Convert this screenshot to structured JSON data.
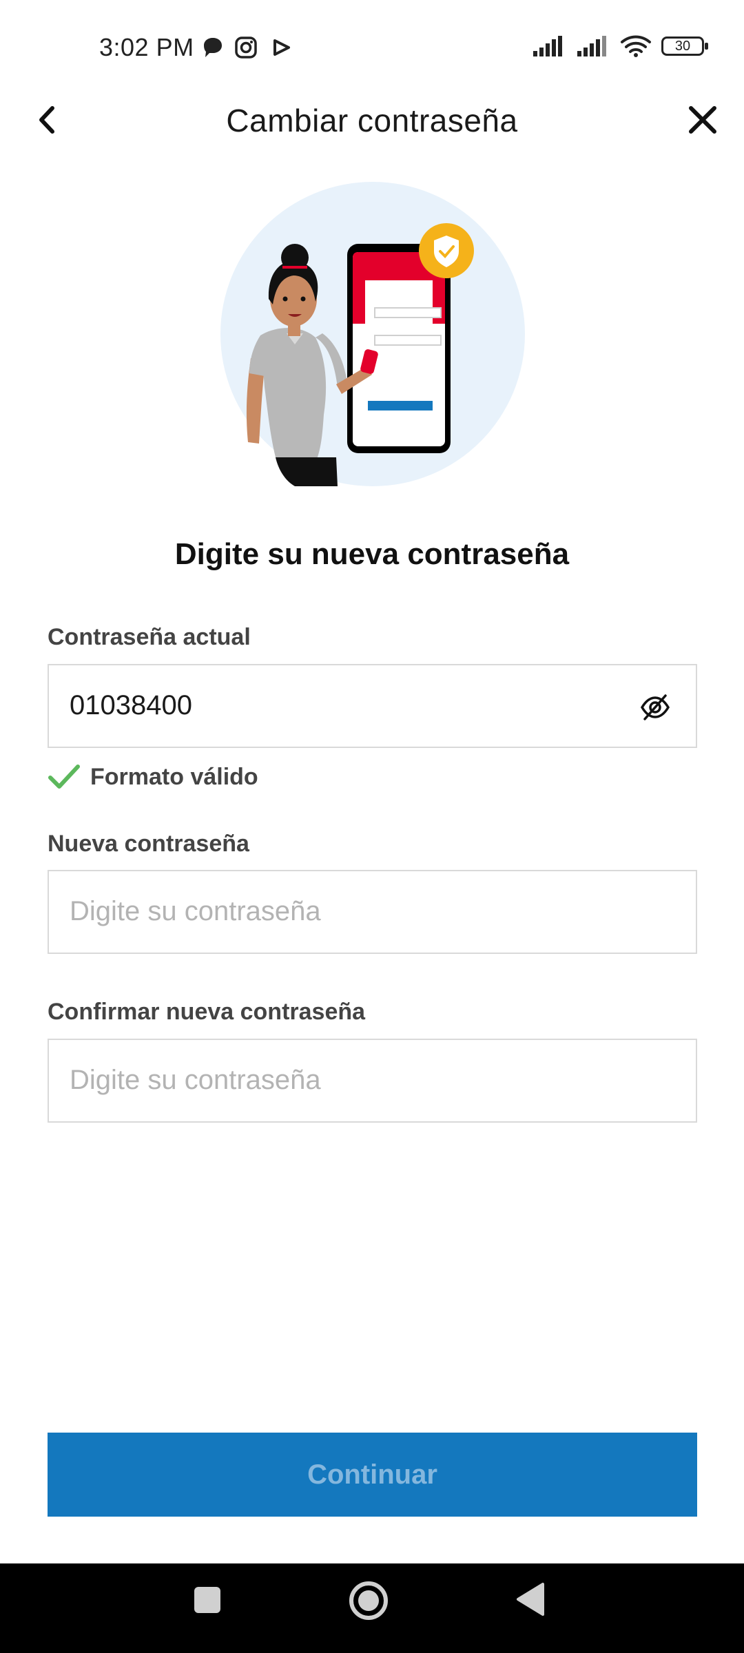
{
  "status_bar": {
    "time": "3:02 PM",
    "battery": "30",
    "icons": [
      "chat-bubble-icon",
      "instagram-icon",
      "play-store-icon",
      "signal-icon",
      "signal-icon",
      "wifi-icon",
      "battery-icon"
    ]
  },
  "header": {
    "title": "Cambiar contraseña",
    "back_icon": "chevron-left-icon",
    "close_icon": "close-icon"
  },
  "illustration": "woman-with-phone-security-illustration",
  "form": {
    "heading": "Digite su nueva contraseña",
    "current_password": {
      "label": "Contraseña actual",
      "value": "01038400",
      "toggle_icon": "eye-off-icon",
      "validation": "Formato válido",
      "validation_icon": "check-icon"
    },
    "new_password": {
      "label": "Nueva contraseña",
      "placeholder": "Digite su contraseña"
    },
    "confirm_password": {
      "label": "Confirmar nueva contraseña",
      "placeholder": "Digite su contraseña"
    }
  },
  "actions": {
    "continue": "Continuar"
  },
  "colors": {
    "primary": "#1478be",
    "primary_text_disabled": "#84b7de",
    "valid_green": "#5cb85c",
    "accent_red": "#e3002b",
    "badge_yellow": "#f5b21a"
  },
  "nav_bar": {
    "items": [
      "recent-apps-icon",
      "home-icon",
      "back-triangle-icon"
    ]
  }
}
